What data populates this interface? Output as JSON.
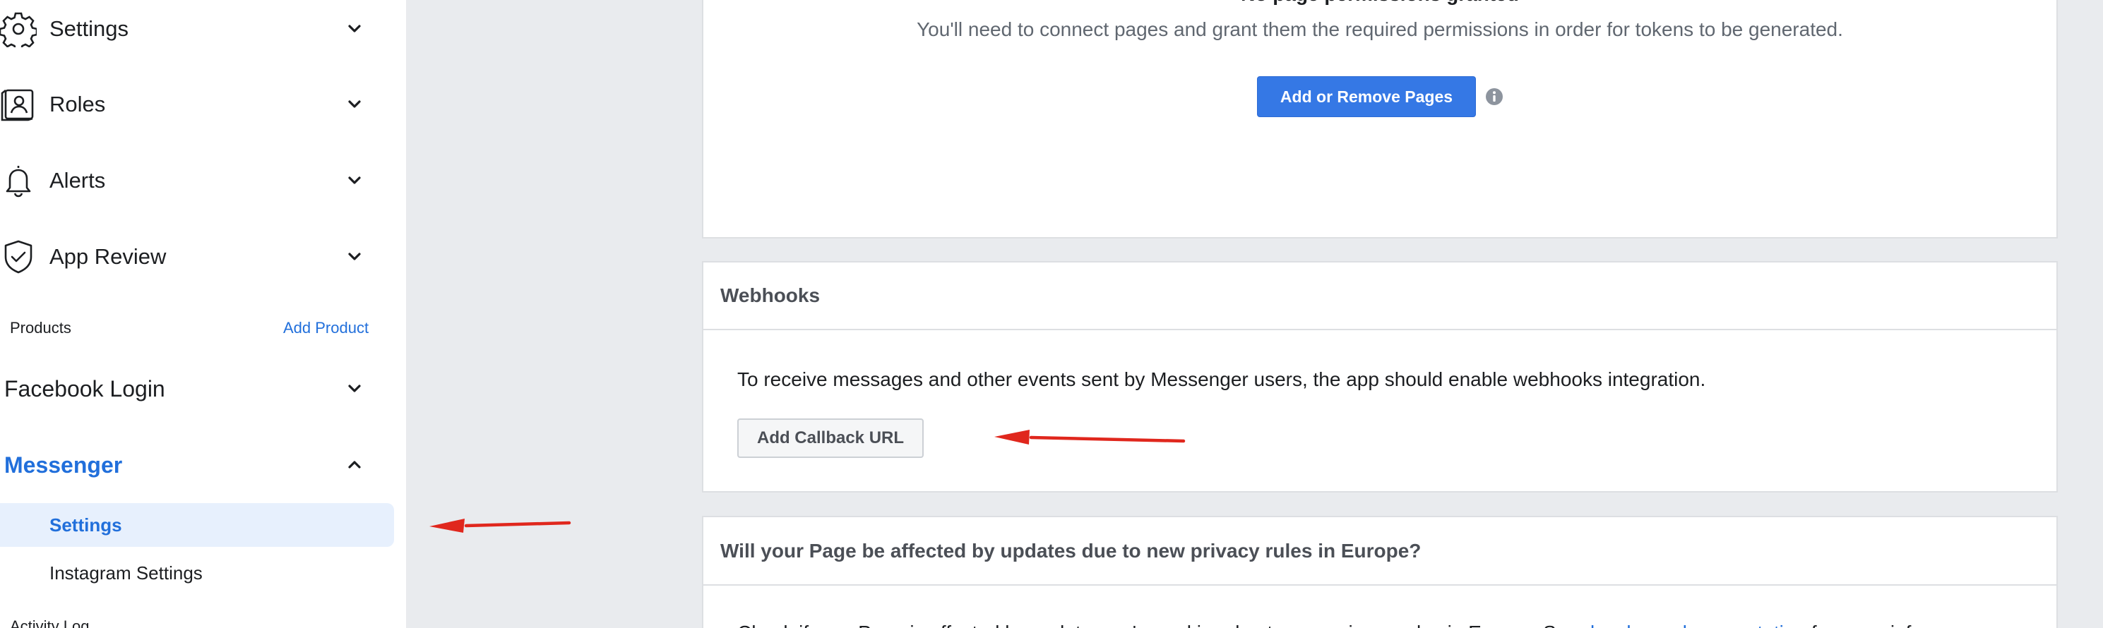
{
  "sidebar": {
    "nav": [
      {
        "label": "Settings",
        "icon": "gear-icon"
      },
      {
        "label": "Roles",
        "icon": "roles-icon"
      },
      {
        "label": "Alerts",
        "icon": "bell-icon"
      },
      {
        "label": "App Review",
        "icon": "shield-check-icon"
      }
    ],
    "products_label": "Products",
    "add_product_label": "Add Product",
    "products": [
      {
        "label": "Facebook Login",
        "expanded": false
      },
      {
        "label": "Messenger",
        "expanded": true
      }
    ],
    "messenger_items": [
      {
        "label": "Settings",
        "selected": true
      },
      {
        "label": "Instagram Settings",
        "selected": false
      }
    ],
    "activity_log": "Activity Log"
  },
  "permissions_card": {
    "title": "No page permissions granted",
    "description": "You'll need to connect pages and grant them the required permissions in order for tokens to be generated.",
    "button_label": "Add or Remove Pages"
  },
  "webhooks_card": {
    "header": "Webhooks",
    "body": "To receive messages and other events sent by Messenger users, the app should enable webhooks integration.",
    "button_label": "Add Callback URL"
  },
  "privacy_card": {
    "header": "Will your Page be affected by updates due to new privacy rules in Europe?",
    "body_start": "Check if your Page is affected by updates we're making due to new privacy rules in Europe. See ",
    "body_link": "developer documentation",
    "body_end": " for more info on"
  },
  "colors": {
    "accent": "#216fdb",
    "primary_button": "#3578e5",
    "background": "#e9ebee",
    "annotation_arrow": "#e0271d"
  }
}
